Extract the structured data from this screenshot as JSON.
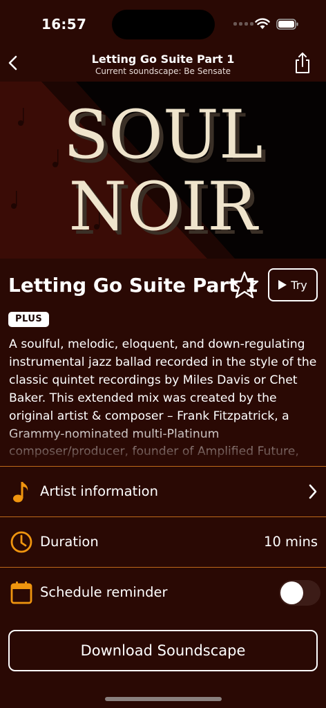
{
  "status_bar": {
    "time": "16:57"
  },
  "nav": {
    "title": "Letting Go Suite Part 1",
    "subtitle": "Current soundscape: Be Sensate"
  },
  "hero": {
    "art_line1": "SOUL",
    "art_line2": "NOIR"
  },
  "track": {
    "title": "Letting Go Suite Part 1",
    "try_label": "Try",
    "badge": "PLUS",
    "description": "A soulful, melodic, eloquent, and down-regulating instrumental jazz ballad recorded in the style of the classic quintet recordings by Miles Davis or Chet Baker. This extended mix was created by the original artist & composer – Frank Fitzpatrick, a Grammy-nominated multi-Platinum composer/producer, founder of Amplified Future, and Apple's former"
  },
  "rows": {
    "artist": {
      "label": "Artist information",
      "icon": "music-note-icon"
    },
    "duration": {
      "label": "Duration",
      "value": "10 mins",
      "icon": "clock-icon"
    },
    "reminder": {
      "label": "Schedule reminder",
      "icon": "calendar-icon",
      "toggle_on": false
    }
  },
  "download_label": "Download Soundscape",
  "colors": {
    "background": "#2a0904",
    "accent": "#f0950f",
    "divider": "#c06a1a"
  }
}
